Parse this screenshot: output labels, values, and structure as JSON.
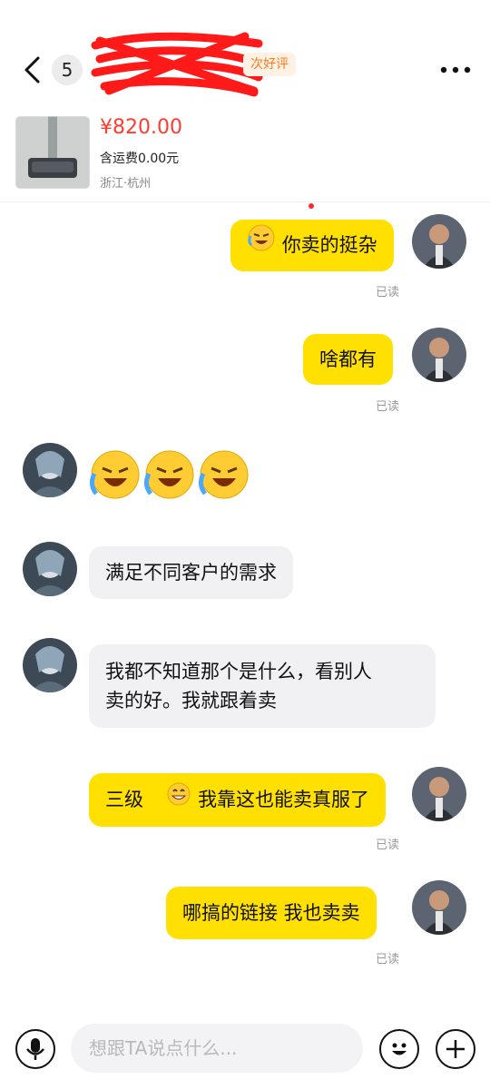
{
  "header": {
    "unread_count": "5",
    "tag_label": "次好评",
    "back_icon": "chevron-left-icon",
    "more_icon": "more-dots-icon"
  },
  "product": {
    "price": "¥820.00",
    "shipping": "含运费0.00元",
    "location": "浙江·杭州"
  },
  "messages": [
    {
      "side": "me",
      "text": "你卖的挺杂",
      "read": "已读"
    },
    {
      "side": "me",
      "text": "啥都有",
      "read": "已读"
    },
    {
      "side": "other",
      "text": "😭😭😭"
    },
    {
      "side": "other",
      "text": "满足不同客户的需求"
    },
    {
      "side": "other",
      "line1": "我都不知道那个是什么，看别人",
      "line2": "卖的好。我就跟着卖"
    },
    {
      "side": "me",
      "prefix": "三级",
      "text": "我靠这也能卖真服了",
      "read": "已读"
    },
    {
      "side": "me",
      "text": "哪搞的链接 我也卖卖",
      "read": "已读"
    }
  ],
  "input": {
    "placeholder": "想跟TA说点什么..."
  },
  "colors": {
    "my_bubble": "#ffe000",
    "other_bubble": "#f1f1f4",
    "price": "#ff3b30",
    "tag": "#ff7a1a"
  }
}
